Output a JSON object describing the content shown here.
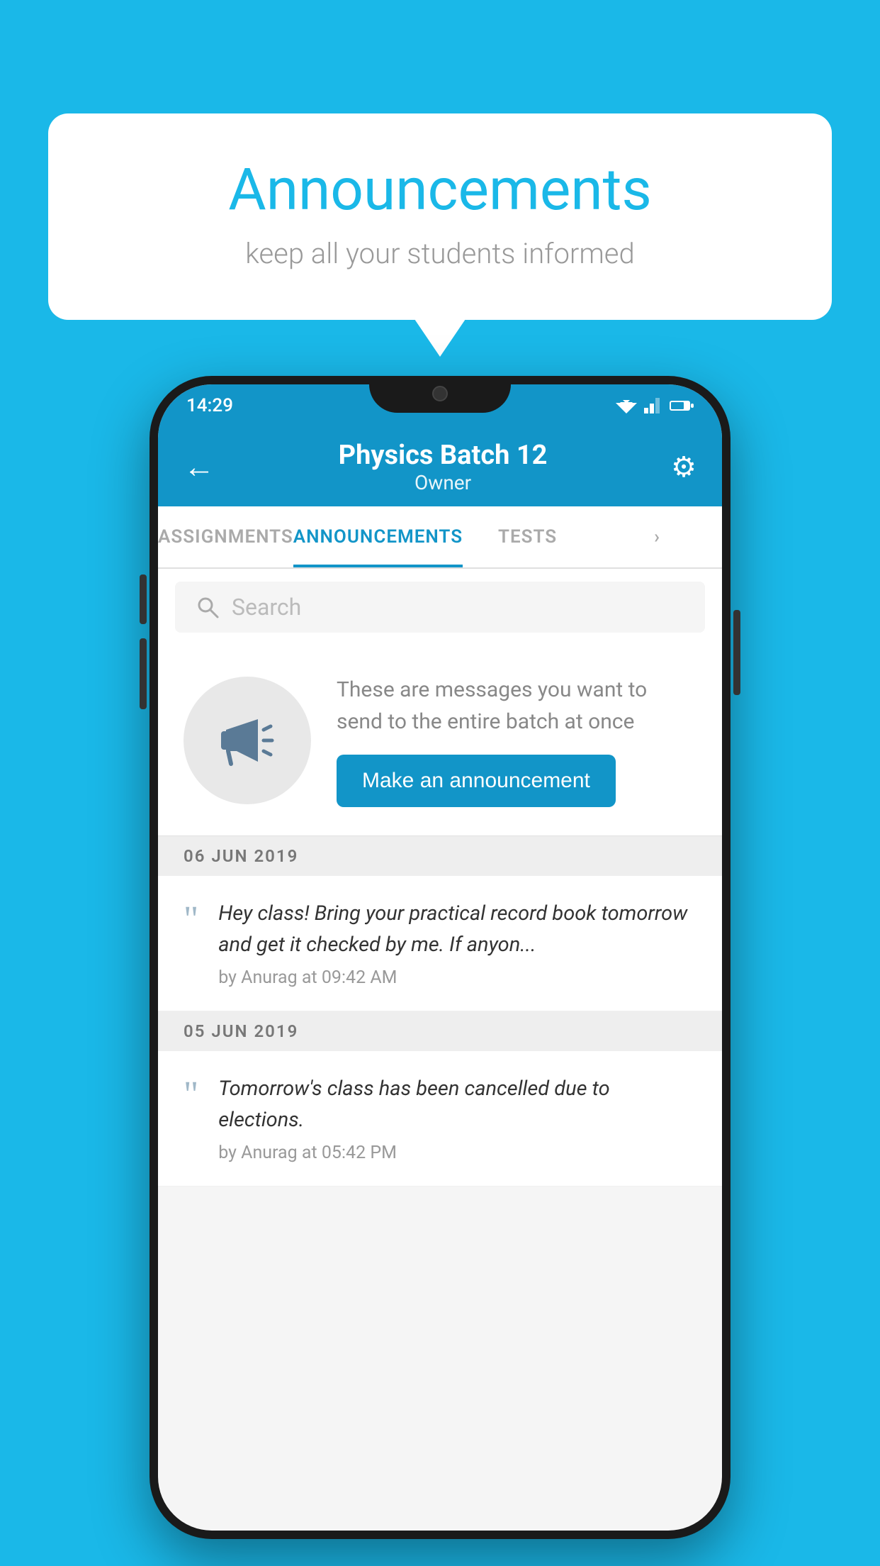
{
  "background_color": "#1ab8e8",
  "speech_bubble": {
    "title": "Announcements",
    "subtitle": "keep all your students informed"
  },
  "phone": {
    "status_bar": {
      "time": "14:29"
    },
    "app_bar": {
      "title": "Physics Batch 12",
      "subtitle": "Owner",
      "back_label": "←",
      "settings_label": "⚙"
    },
    "tabs": [
      {
        "label": "ASSIGNMENTS",
        "active": false
      },
      {
        "label": "ANNOUNCEMENTS",
        "active": true
      },
      {
        "label": "TESTS",
        "active": false
      },
      {
        "label": "...",
        "active": false
      }
    ],
    "search": {
      "placeholder": "Search"
    },
    "announcement_prompt": {
      "description": "These are messages you want to send to the entire batch at once",
      "button_label": "Make an announcement"
    },
    "date_groups": [
      {
        "date": "06  JUN  2019",
        "announcements": [
          {
            "text": "Hey class! Bring your practical record book tomorrow and get it checked by me. If anyon...",
            "meta": "by Anurag at 09:42 AM"
          }
        ]
      },
      {
        "date": "05  JUN  2019",
        "announcements": [
          {
            "text": "Tomorrow's class has been cancelled due to elections.",
            "meta": "by Anurag at 05:42 PM"
          }
        ]
      }
    ]
  }
}
